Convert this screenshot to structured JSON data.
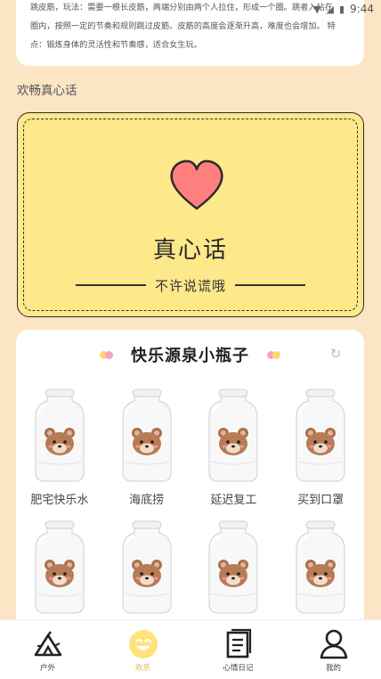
{
  "status_bar": {
    "time": "9:44"
  },
  "rules": {
    "lines": [
      "跳皮筋，玩法：需要一根长皮筋，两端分别由两个人拉住，形成一个圈。跳者入站在",
      "圈内，按照一定的节奏和规则跳过皮筋。皮筋的高度会逐渐升高，难度也会增加。 特",
      "点：锻炼身体的灵活性和节奏感，适合女生玩。"
    ]
  },
  "section_title": "欢畅真心话",
  "truth_card": {
    "title": "真心话",
    "subtitle": "不许说谎哦",
    "heart_color": "#ff7f7f"
  },
  "bottles": {
    "title": "快乐源泉小瓶子",
    "items": [
      {
        "label": "肥宅快乐水"
      },
      {
        "label": "海底捞"
      },
      {
        "label": "延迟复工"
      },
      {
        "label": "买到口罩"
      },
      {
        "label": ""
      },
      {
        "label": ""
      },
      {
        "label": ""
      },
      {
        "label": ""
      }
    ]
  },
  "nav": {
    "items": [
      {
        "label": "户外",
        "icon": "tent-icon"
      },
      {
        "label": "欢乐",
        "icon": "smile-icon"
      },
      {
        "label": "心情日记",
        "icon": "diary-icon"
      },
      {
        "label": "我的",
        "icon": "user-icon"
      }
    ]
  },
  "colors": {
    "background": "#fbe5c4",
    "card_yellow": "#fde88a",
    "accent_yellow": "#ffd966",
    "accent_pink": "#f6a5c0",
    "active_nav": "#e3b341"
  }
}
